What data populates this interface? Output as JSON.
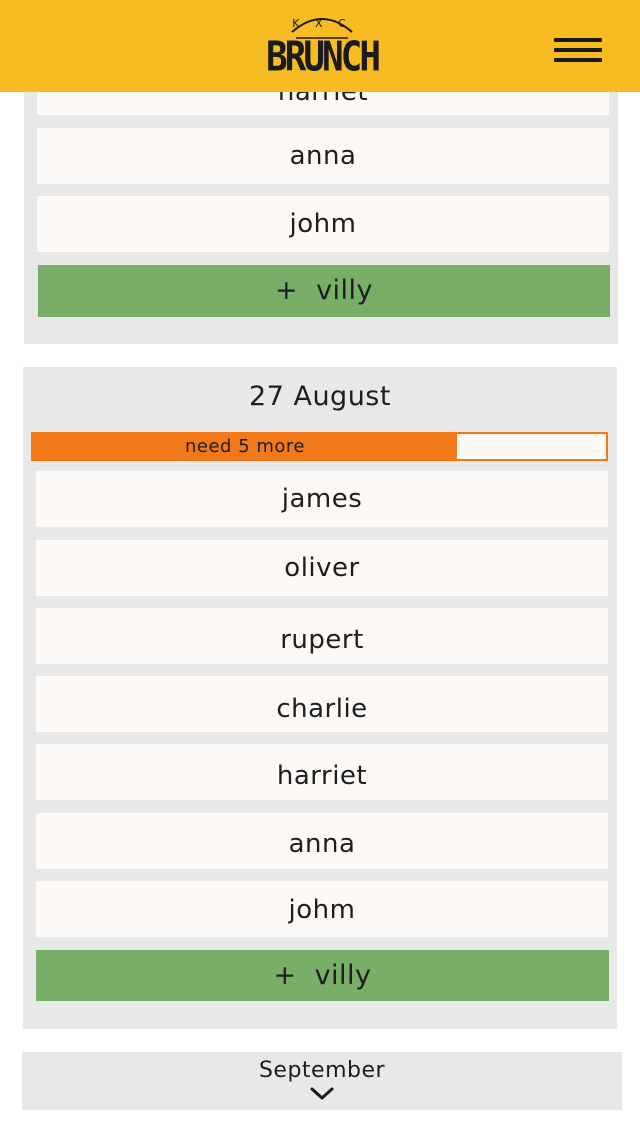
{
  "header": {
    "logo_top": "K X C",
    "logo_text": "BRUNCH",
    "brand_color": "#f7bc24",
    "menu_icon": "hamburger-menu-icon"
  },
  "previous_date": {
    "attendees": [
      "harriet",
      "anna",
      "johm"
    ],
    "add_button": {
      "plus": "+",
      "name": "villy"
    }
  },
  "current_date": {
    "title": "27 August",
    "progress": {
      "label": "need 5 more",
      "fraction": 0.74,
      "color": "#f2791a"
    },
    "attendees": [
      "james",
      "oliver",
      "rupert",
      "charlie",
      "harriet",
      "anna",
      "johm"
    ],
    "add_button": {
      "plus": "+",
      "name": "villy",
      "color": "#79ae69"
    }
  },
  "next_month": {
    "label": "September",
    "icon": "chevron-down-icon"
  }
}
